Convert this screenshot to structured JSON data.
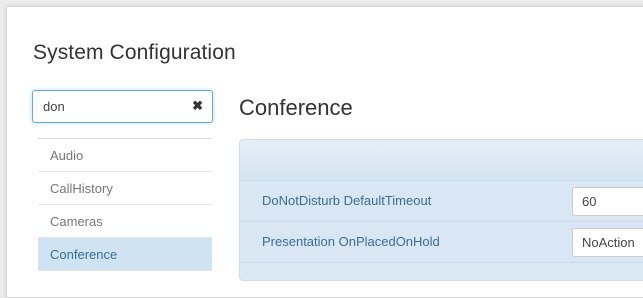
{
  "page": {
    "title": "System Configuration"
  },
  "search": {
    "value": "don",
    "clear_icon": "✖"
  },
  "sidebar": {
    "items": [
      {
        "label": "Audio",
        "active": false
      },
      {
        "label": "CallHistory",
        "active": false
      },
      {
        "label": "Cameras",
        "active": false
      },
      {
        "label": "Conference",
        "active": true
      }
    ]
  },
  "main": {
    "section_title": "Conference",
    "settings": [
      {
        "label": "DoNotDisturb DefaultTimeout",
        "value": "60"
      },
      {
        "label": "Presentation OnPlacedOnHold",
        "value": "NoAction"
      }
    ]
  },
  "colors": {
    "accent": "#69a6d8",
    "active_nav_bg": "#cfe3f2",
    "settings_bg": "#dbe9f4",
    "label_blue": "#3b6d98"
  },
  "icons": {
    "clear": "close-icon"
  }
}
